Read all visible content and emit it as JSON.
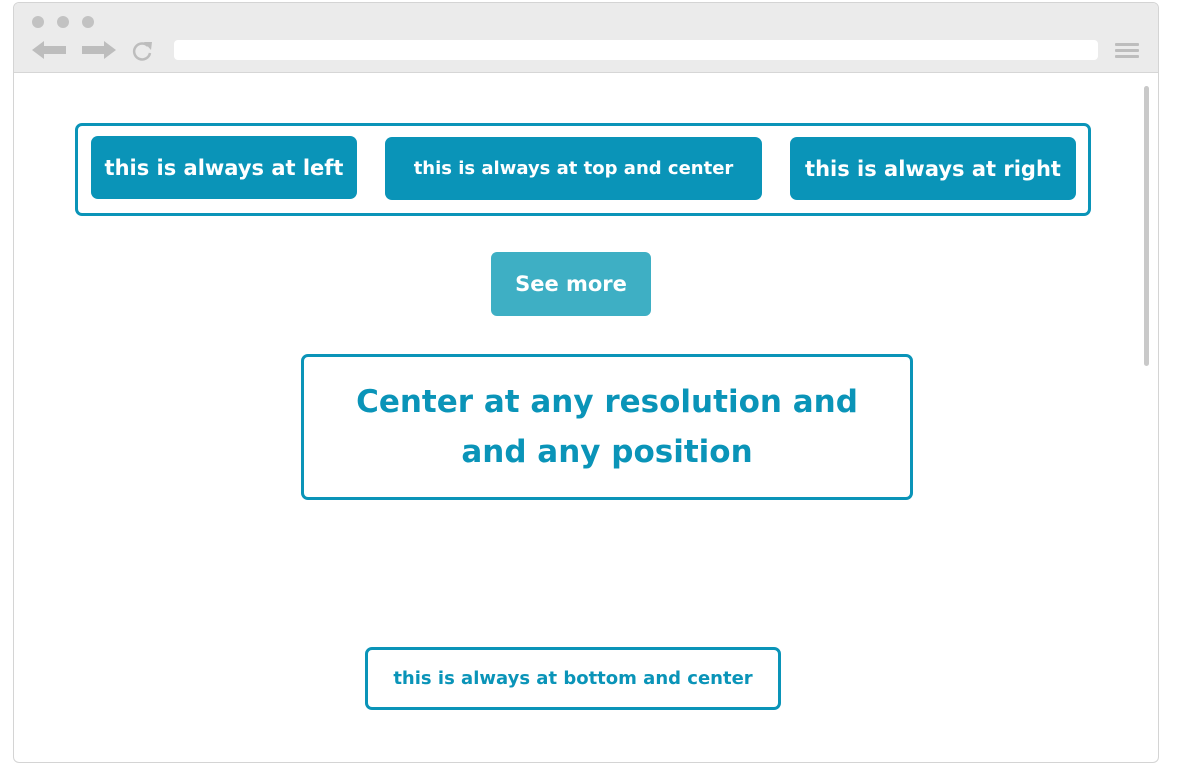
{
  "browser": {
    "address_value": "",
    "icons": [
      "window-dot-icon",
      "back-arrow-icon",
      "forward-arrow-icon",
      "reload-icon",
      "hamburger-menu-icon"
    ],
    "chrome_color": "#ebebeb"
  },
  "top_bar": {
    "left_label": "this is always at left",
    "center_label": "this is always at top and center",
    "right_label": "this is always at right"
  },
  "see_more": {
    "label": "See more"
  },
  "center_box": {
    "text": "Center at any resolution and and any position"
  },
  "bottom": {
    "label": "this is always at bottom and center"
  },
  "colors": {
    "accent": "#0a94b8",
    "see_more_bg": "#3eafc4"
  }
}
